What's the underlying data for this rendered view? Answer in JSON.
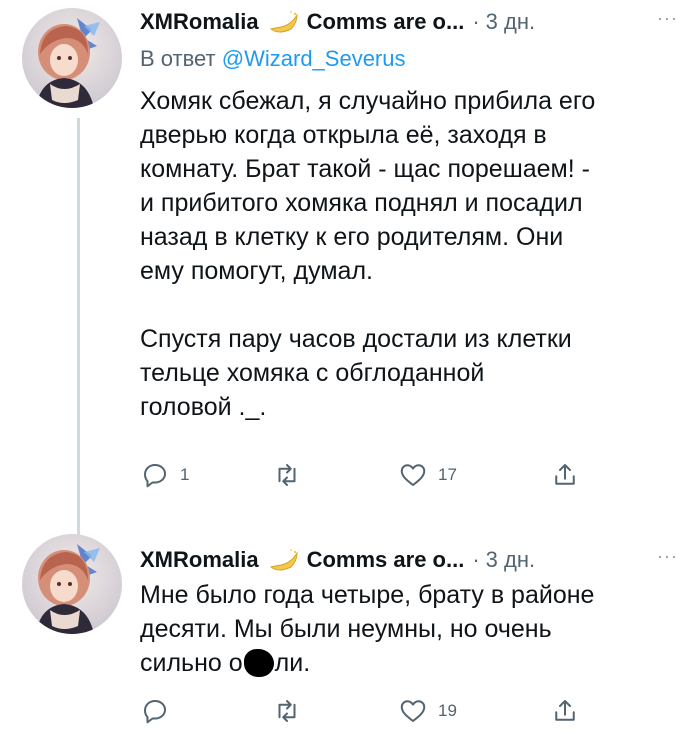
{
  "tweets": [
    {
      "author_name": "XMRomalia",
      "handle": "Comms are o...",
      "separator": "·",
      "time": "3 дн.",
      "more": "···",
      "reply_prefix": "В ответ",
      "reply_mention": "@Wizard_Severus",
      "text": "Хомяк сбежал, я случайно прибила его\nдверью когда открыла её, заходя в\nкомнату. Брат такой - щас порешаем! -\nи прибитого хомяка поднял и посадил\nназад в клетку к его родителям. Они\nему помогут, думал.\n\nСпустя пару часов достали из клетки\nтельце хомяка с обглоданной\nголовой ._.",
      "replies": "1",
      "retweets": "",
      "likes": "17"
    },
    {
      "author_name": "XMRomalia",
      "handle": "Comms are o...",
      "separator": "·",
      "time": "3 дн.",
      "more": "···",
      "text_before": "Мне было года четыре, брату в районе\nдесяти. Мы были неумны, но очень\nсильно о",
      "text_after": "ли.",
      "replies": "",
      "retweets": "",
      "likes": "19"
    }
  ],
  "colors": {
    "text": "#0f1419",
    "secondary": "#536471",
    "link": "#1d9bf0",
    "thread_line": "#cfd9de"
  },
  "icons": {
    "reply": "reply-icon",
    "retweet": "retweet-icon",
    "like": "heart-icon",
    "share": "share-icon",
    "badge": "crescent-moon-icon"
  }
}
